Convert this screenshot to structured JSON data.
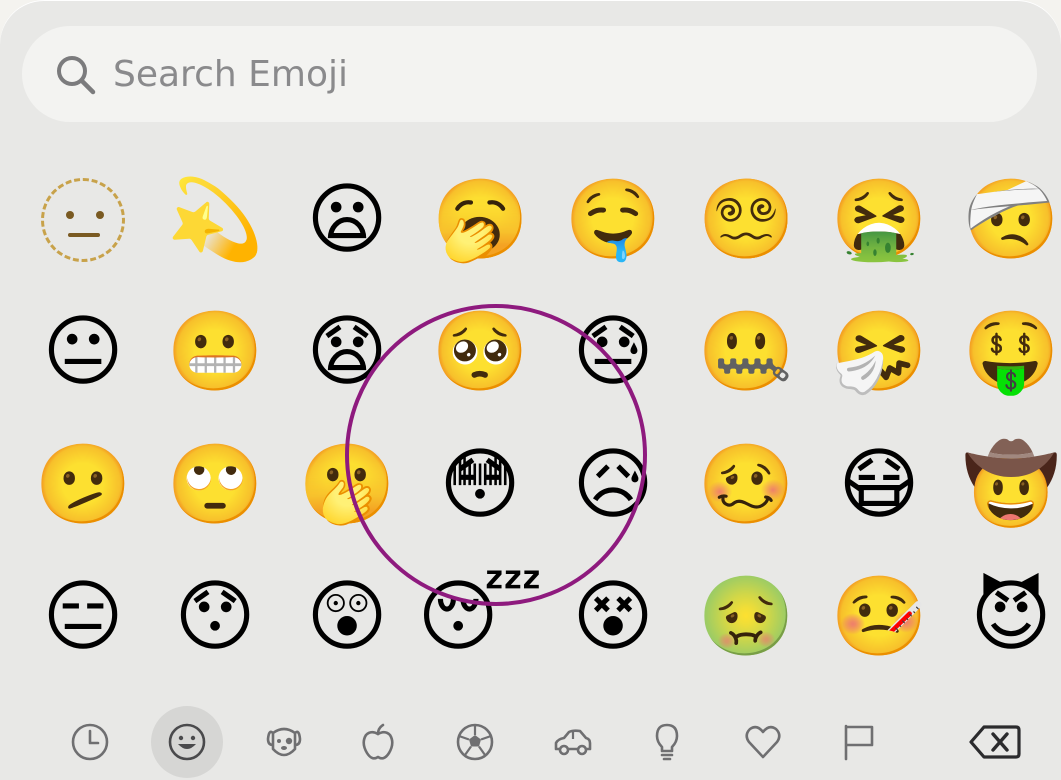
{
  "search": {
    "placeholder": "Search Emoji",
    "icon": "magnifying-glass-icon"
  },
  "emoji_rows": [
    [
      "dotted-line-face",
      "💫",
      "😦",
      "🥱",
      "🤤",
      "😵‍💫",
      "🤮",
      "🤕"
    ],
    [
      "😐",
      "😬",
      "😧",
      "🥺",
      "😓",
      "🤐",
      "🤧",
      "🤑"
    ],
    [
      "🫤",
      "🙄",
      "🫢",
      "😳",
      "😥",
      "🥴",
      "😷",
      "🤠"
    ],
    [
      "😑",
      "😯",
      "😲",
      "😴",
      "😵",
      "🤢",
      "🤒",
      "😈"
    ]
  ],
  "highlight": {
    "color": "#8e1a7e",
    "target": "😳"
  },
  "categories": [
    {
      "name": "recent",
      "icon": "clock-icon",
      "active": false
    },
    {
      "name": "smileys",
      "icon": "smiley-icon",
      "active": true
    },
    {
      "name": "animals",
      "icon": "dog-icon",
      "active": false
    },
    {
      "name": "food",
      "icon": "apple-icon",
      "active": false
    },
    {
      "name": "activity",
      "icon": "soccer-ball-icon",
      "active": false
    },
    {
      "name": "travel",
      "icon": "car-icon",
      "active": false
    },
    {
      "name": "objects",
      "icon": "lightbulb-icon",
      "active": false
    },
    {
      "name": "symbols",
      "icon": "heart-icon",
      "active": false
    },
    {
      "name": "flags",
      "icon": "flag-icon",
      "active": false
    }
  ],
  "delete_key": {
    "icon": "backspace-icon"
  },
  "colors": {
    "keyboard_bg": "#e8e8e6",
    "search_bg": "#f3f3f1",
    "placeholder": "#8a8a8c",
    "icon_gray": "#6f6f71",
    "active_category_bg": "#d6d6d4"
  }
}
